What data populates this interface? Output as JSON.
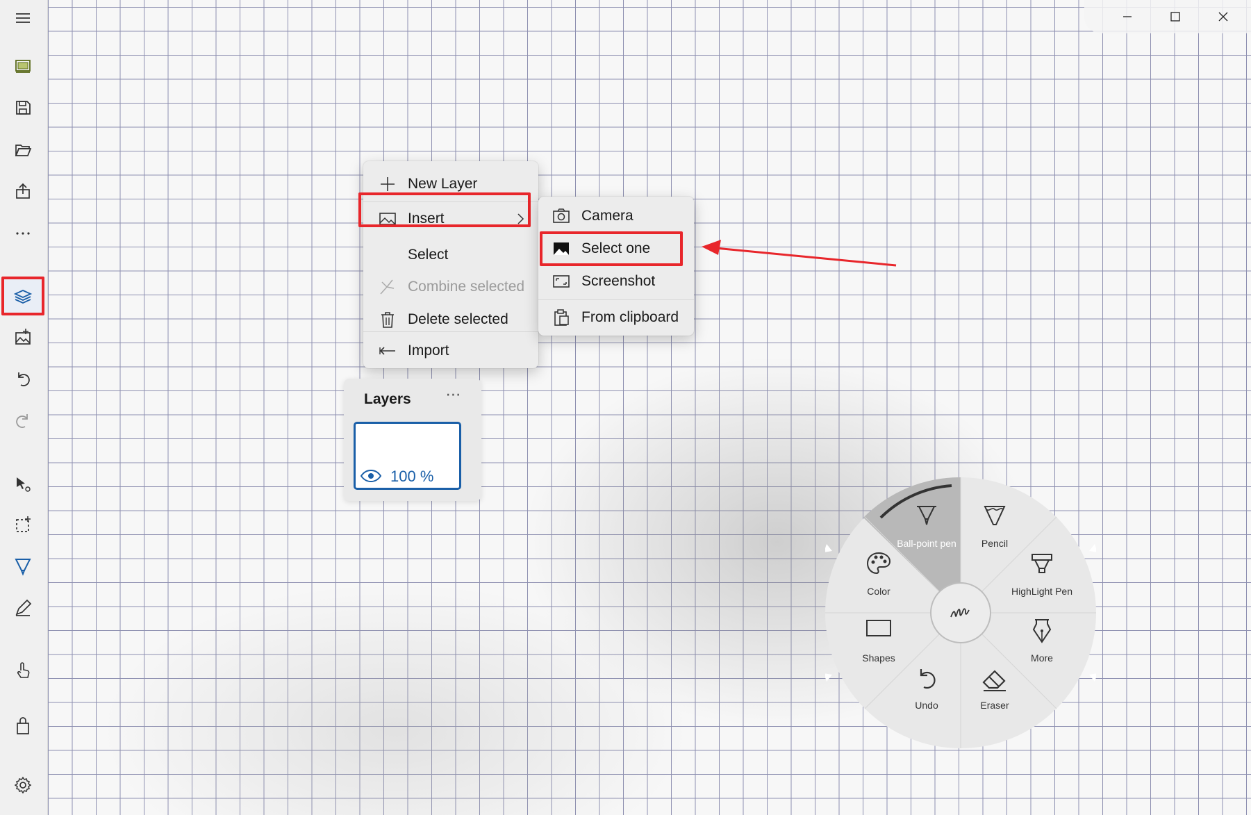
{
  "toolbar": {
    "items": [
      {
        "name": "hamburger-menu-icon"
      },
      {
        "name": "slideshow-icon"
      },
      {
        "name": "save-icon"
      },
      {
        "name": "open-folder-icon"
      },
      {
        "name": "share-icon"
      },
      {
        "name": "more-icon"
      },
      {
        "name": "layers-icon"
      },
      {
        "name": "insert-image-icon"
      },
      {
        "name": "undo-icon"
      },
      {
        "name": "redo-icon"
      },
      {
        "name": "select-tool-icon"
      },
      {
        "name": "lasso-select-icon"
      },
      {
        "name": "pen-tool-icon"
      },
      {
        "name": "pencil-tool-icon"
      },
      {
        "name": "touch-icon"
      },
      {
        "name": "store-icon"
      },
      {
        "name": "settings-icon"
      }
    ],
    "accent": "#1a5fa8"
  },
  "context_menu": {
    "items": [
      {
        "label": "New Layer",
        "icon": "plus-icon",
        "enabled": true
      },
      {
        "label": "Insert",
        "icon": "image-icon",
        "enabled": true,
        "has_submenu": true
      },
      {
        "label": "Select",
        "icon": "",
        "enabled": true
      },
      {
        "label": "Combine selected",
        "icon": "combine-icon",
        "enabled": false
      },
      {
        "label": "Delete selected",
        "icon": "trash-icon",
        "enabled": true
      },
      {
        "label": "Import",
        "icon": "import-icon",
        "enabled": true
      }
    ]
  },
  "insert_submenu": {
    "items": [
      {
        "label": "Camera",
        "icon": "camera-icon"
      },
      {
        "label": "Select one",
        "icon": "picture-icon"
      },
      {
        "label": "Screenshot",
        "icon": "screenshot-icon"
      },
      {
        "label": "From clipboard",
        "icon": "clipboard-icon"
      }
    ]
  },
  "layers_panel": {
    "title": "Layers",
    "more": "⋯",
    "layer_opacity": "100 %"
  },
  "radial_menu": {
    "center_icon": "ink-signature-icon",
    "items": [
      {
        "label": "Ball-point pen",
        "icon": "ballpoint-pen-icon"
      },
      {
        "label": "Pencil",
        "icon": "pencil-icon"
      },
      {
        "label": "Color",
        "icon": "palette-icon"
      },
      {
        "label": "HighLight Pen",
        "icon": "highlighter-icon"
      },
      {
        "label": "Shapes",
        "icon": "rectangle-icon"
      },
      {
        "label": "More",
        "icon": "fountain-pen-icon"
      },
      {
        "label": "Undo",
        "icon": "undo-icon"
      },
      {
        "label": "Eraser",
        "icon": "eraser-icon"
      }
    ]
  },
  "colors": {
    "highlight": "#e8262b",
    "grid": "#8d8fb0"
  }
}
